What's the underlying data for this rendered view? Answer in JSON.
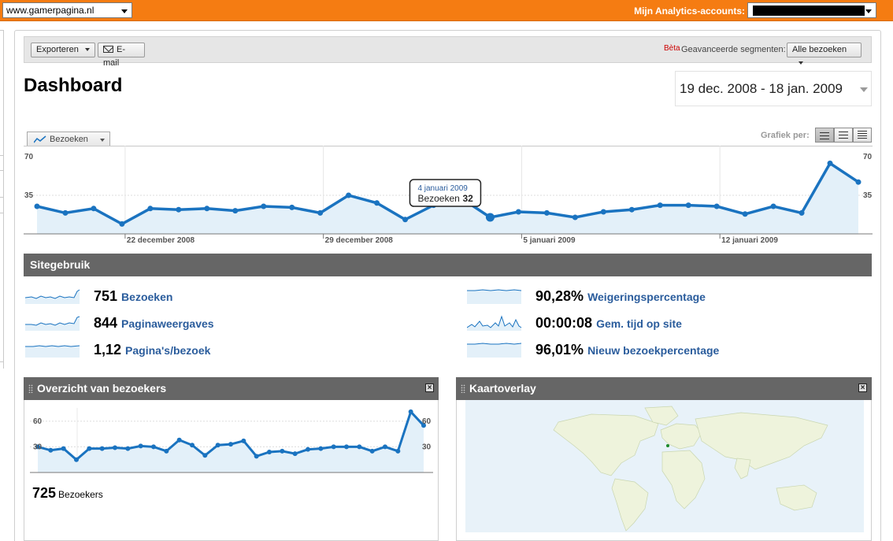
{
  "topbar": {
    "site_value": "www.gamerpagina.nl",
    "accounts_label": "Mijn Analytics-accounts:"
  },
  "toolbar": {
    "export_label": "Exporteren",
    "email_label": "E-mail",
    "beta_label": "Bèta",
    "segments_label": "Geavanceerde segmenten:",
    "segments_value": "Alle bezoeken"
  },
  "page": {
    "title": "Dashboard",
    "date_range": "19 dec. 2008 - 18 jan. 2009"
  },
  "graph_controls": {
    "metric_label": "Bezoeken",
    "graph_per_label": "Grafiek per:"
  },
  "colors": {
    "accent_orange": "#f57c12",
    "line_blue": "#1a73c0",
    "header_gray": "#666666",
    "link_blue": "#2a5c9c"
  },
  "chart_data": [
    {
      "type": "area",
      "series": [
        {
          "name": "Bezoeken",
          "values": [
            25,
            19,
            23,
            9,
            23,
            22,
            23,
            21,
            25,
            24,
            19,
            35,
            28,
            13,
            26,
            32,
            15,
            20,
            19,
            15,
            20,
            22,
            26,
            26,
            25,
            18,
            25,
            19,
            64,
            47
          ]
        }
      ],
      "ylim": [
        0,
        70
      ],
      "yticks": [
        "35",
        "70"
      ],
      "xticks": [
        {
          "index": 3,
          "label": "22 december 2008"
        },
        {
          "index": 10,
          "label": "29 december 2008"
        },
        {
          "index": 17,
          "label": "5 januari 2009"
        },
        {
          "index": 24,
          "label": "12 januari 2009"
        }
      ],
      "tooltip": {
        "index": 16,
        "date": "4 januari 2009",
        "label": "Bezoeken",
        "value": "32"
      },
      "grid": true
    },
    {
      "type": "area",
      "series": [
        {
          "name": "Bezoekers",
          "values": [
            30,
            26,
            28,
            15,
            28,
            28,
            29,
            28,
            31,
            30,
            25,
            38,
            32,
            20,
            32,
            33,
            37,
            19,
            24,
            25,
            22,
            27,
            28,
            30,
            30,
            30,
            25,
            30,
            25,
            71,
            55
          ]
        }
      ],
      "ylim": [
        0,
        70
      ],
      "yticks": [
        "30",
        "60"
      ],
      "grid": true
    }
  ],
  "sitegebruik": {
    "title": "Sitegebruik",
    "stats": [
      {
        "value": "751",
        "label": "Bezoeken"
      },
      {
        "value": "844",
        "label": "Paginaweergaves"
      },
      {
        "value": "1,12",
        "label": "Pagina's/bezoek"
      },
      {
        "value": "90,28%",
        "label": "Weigeringspercentage"
      },
      {
        "value": "00:00:08",
        "label": "Gem. tijd op site"
      },
      {
        "value": "96,01%",
        "label": "Nieuw bezoekpercentage"
      }
    ]
  },
  "widgets": {
    "visitors_title": "Overzicht van bezoekers",
    "visitors_count": "725",
    "visitors_label": "Bezoekers",
    "map_title": "Kaartoverlay"
  }
}
